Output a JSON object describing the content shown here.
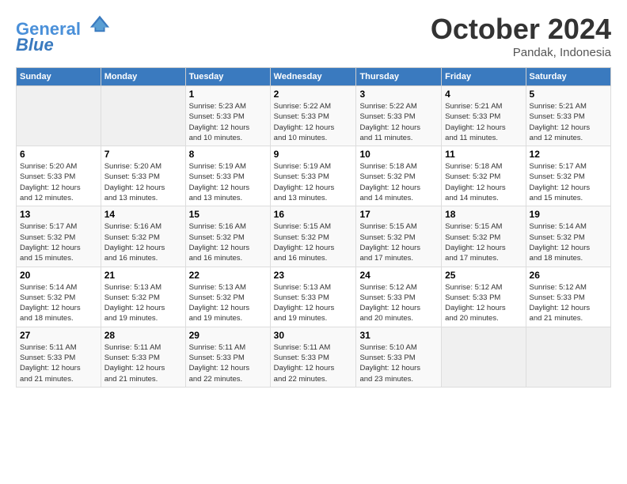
{
  "header": {
    "logo_line1": "General",
    "logo_line2": "Blue",
    "month": "October 2024",
    "location": "Pandak, Indonesia"
  },
  "weekdays": [
    "Sunday",
    "Monday",
    "Tuesday",
    "Wednesday",
    "Thursday",
    "Friday",
    "Saturday"
  ],
  "weeks": [
    [
      {
        "num": "",
        "info": ""
      },
      {
        "num": "",
        "info": ""
      },
      {
        "num": "1",
        "info": "Sunrise: 5:23 AM\nSunset: 5:33 PM\nDaylight: 12 hours\nand 10 minutes."
      },
      {
        "num": "2",
        "info": "Sunrise: 5:22 AM\nSunset: 5:33 PM\nDaylight: 12 hours\nand 10 minutes."
      },
      {
        "num": "3",
        "info": "Sunrise: 5:22 AM\nSunset: 5:33 PM\nDaylight: 12 hours\nand 11 minutes."
      },
      {
        "num": "4",
        "info": "Sunrise: 5:21 AM\nSunset: 5:33 PM\nDaylight: 12 hours\nand 11 minutes."
      },
      {
        "num": "5",
        "info": "Sunrise: 5:21 AM\nSunset: 5:33 PM\nDaylight: 12 hours\nand 12 minutes."
      }
    ],
    [
      {
        "num": "6",
        "info": "Sunrise: 5:20 AM\nSunset: 5:33 PM\nDaylight: 12 hours\nand 12 minutes."
      },
      {
        "num": "7",
        "info": "Sunrise: 5:20 AM\nSunset: 5:33 PM\nDaylight: 12 hours\nand 13 minutes."
      },
      {
        "num": "8",
        "info": "Sunrise: 5:19 AM\nSunset: 5:33 PM\nDaylight: 12 hours\nand 13 minutes."
      },
      {
        "num": "9",
        "info": "Sunrise: 5:19 AM\nSunset: 5:33 PM\nDaylight: 12 hours\nand 13 minutes."
      },
      {
        "num": "10",
        "info": "Sunrise: 5:18 AM\nSunset: 5:32 PM\nDaylight: 12 hours\nand 14 minutes."
      },
      {
        "num": "11",
        "info": "Sunrise: 5:18 AM\nSunset: 5:32 PM\nDaylight: 12 hours\nand 14 minutes."
      },
      {
        "num": "12",
        "info": "Sunrise: 5:17 AM\nSunset: 5:32 PM\nDaylight: 12 hours\nand 15 minutes."
      }
    ],
    [
      {
        "num": "13",
        "info": "Sunrise: 5:17 AM\nSunset: 5:32 PM\nDaylight: 12 hours\nand 15 minutes."
      },
      {
        "num": "14",
        "info": "Sunrise: 5:16 AM\nSunset: 5:32 PM\nDaylight: 12 hours\nand 16 minutes."
      },
      {
        "num": "15",
        "info": "Sunrise: 5:16 AM\nSunset: 5:32 PM\nDaylight: 12 hours\nand 16 minutes."
      },
      {
        "num": "16",
        "info": "Sunrise: 5:15 AM\nSunset: 5:32 PM\nDaylight: 12 hours\nand 16 minutes."
      },
      {
        "num": "17",
        "info": "Sunrise: 5:15 AM\nSunset: 5:32 PM\nDaylight: 12 hours\nand 17 minutes."
      },
      {
        "num": "18",
        "info": "Sunrise: 5:15 AM\nSunset: 5:32 PM\nDaylight: 12 hours\nand 17 minutes."
      },
      {
        "num": "19",
        "info": "Sunrise: 5:14 AM\nSunset: 5:32 PM\nDaylight: 12 hours\nand 18 minutes."
      }
    ],
    [
      {
        "num": "20",
        "info": "Sunrise: 5:14 AM\nSunset: 5:32 PM\nDaylight: 12 hours\nand 18 minutes."
      },
      {
        "num": "21",
        "info": "Sunrise: 5:13 AM\nSunset: 5:32 PM\nDaylight: 12 hours\nand 19 minutes."
      },
      {
        "num": "22",
        "info": "Sunrise: 5:13 AM\nSunset: 5:32 PM\nDaylight: 12 hours\nand 19 minutes."
      },
      {
        "num": "23",
        "info": "Sunrise: 5:13 AM\nSunset: 5:33 PM\nDaylight: 12 hours\nand 19 minutes."
      },
      {
        "num": "24",
        "info": "Sunrise: 5:12 AM\nSunset: 5:33 PM\nDaylight: 12 hours\nand 20 minutes."
      },
      {
        "num": "25",
        "info": "Sunrise: 5:12 AM\nSunset: 5:33 PM\nDaylight: 12 hours\nand 20 minutes."
      },
      {
        "num": "26",
        "info": "Sunrise: 5:12 AM\nSunset: 5:33 PM\nDaylight: 12 hours\nand 21 minutes."
      }
    ],
    [
      {
        "num": "27",
        "info": "Sunrise: 5:11 AM\nSunset: 5:33 PM\nDaylight: 12 hours\nand 21 minutes."
      },
      {
        "num": "28",
        "info": "Sunrise: 5:11 AM\nSunset: 5:33 PM\nDaylight: 12 hours\nand 21 minutes."
      },
      {
        "num": "29",
        "info": "Sunrise: 5:11 AM\nSunset: 5:33 PM\nDaylight: 12 hours\nand 22 minutes."
      },
      {
        "num": "30",
        "info": "Sunrise: 5:11 AM\nSunset: 5:33 PM\nDaylight: 12 hours\nand 22 minutes."
      },
      {
        "num": "31",
        "info": "Sunrise: 5:10 AM\nSunset: 5:33 PM\nDaylight: 12 hours\nand 23 minutes."
      },
      {
        "num": "",
        "info": ""
      },
      {
        "num": "",
        "info": ""
      }
    ]
  ]
}
